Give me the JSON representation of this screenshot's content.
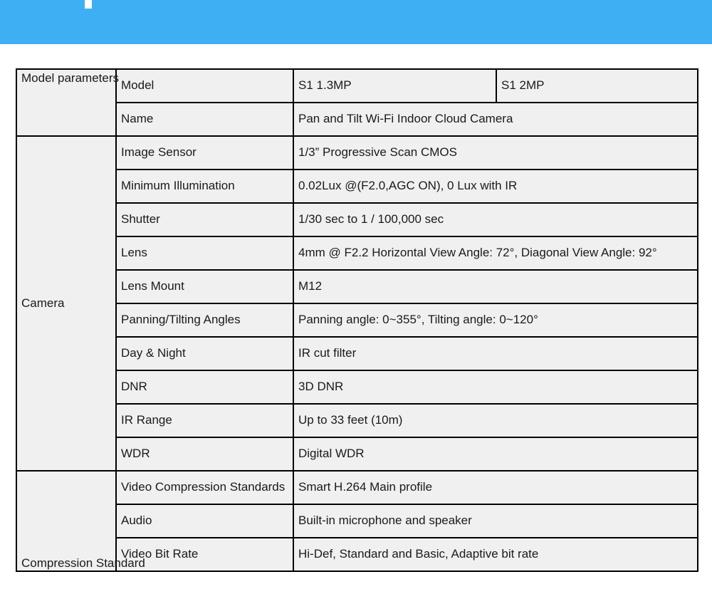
{
  "banner": {
    "color": "#3FAFF4",
    "mark_color": "#ffffff",
    "mark_name": "partial-logo-mark"
  },
  "table": {
    "border_color": "#000000",
    "cell_background": "#F0F0F0",
    "sections": [
      {
        "label": "Model parameters",
        "rows": [
          {
            "key": "Model",
            "values": [
              "S1 1.3MP",
              "S1 2MP"
            ],
            "split": true
          },
          {
            "key": "Name",
            "values": [
              "Pan and Tilt Wi-Fi Indoor Cloud Camera"
            ],
            "split": false
          }
        ]
      },
      {
        "label": "Camera",
        "rows": [
          {
            "key": "Image Sensor",
            "values": [
              "1/3” Progressive Scan CMOS"
            ],
            "split": false
          },
          {
            "key": "Minimum Illumination",
            "values": [
              "0.02Lux @(F2.0,AGC ON), 0 Lux with IR"
            ],
            "split": false
          },
          {
            "key": "Shutter",
            "values": [
              "1/30 sec to 1 / 100,000 sec"
            ],
            "split": false
          },
          {
            "key": "Lens",
            "values": [
              "4mm @ F2.2 Horizontal View Angle: 72°, Diagonal View Angle: 92°"
            ],
            "split": false
          },
          {
            "key": "Lens Mount",
            "values": [
              "M12"
            ],
            "split": false
          },
          {
            "key": "Panning/Tilting Angles",
            "values": [
              "Panning angle: 0~355°, Tilting angle: 0~120°"
            ],
            "split": false
          },
          {
            "key": "Day & Night",
            "values": [
              "IR cut filter"
            ],
            "split": false
          },
          {
            "key": "DNR",
            "values": [
              "3D DNR"
            ],
            "split": false
          },
          {
            "key": "IR Range",
            "values": [
              "Up to 33 feet (10m)"
            ],
            "split": false
          },
          {
            "key": "WDR",
            "values": [
              "Digital WDR"
            ],
            "split": false
          }
        ]
      },
      {
        "label": "Compression Standard",
        "rows": [
          {
            "key": "Video Compression Standards",
            "values": [
              "Smart H.264  Main profile"
            ],
            "split": false
          },
          {
            "key": "Audio",
            "values": [
              "Built-in microphone and speaker"
            ],
            "split": false
          },
          {
            "key": "Video Bit Rate",
            "values": [
              "Hi-Def, Standard and Basic, Adaptive bit rate"
            ],
            "split": false
          }
        ]
      }
    ]
  }
}
